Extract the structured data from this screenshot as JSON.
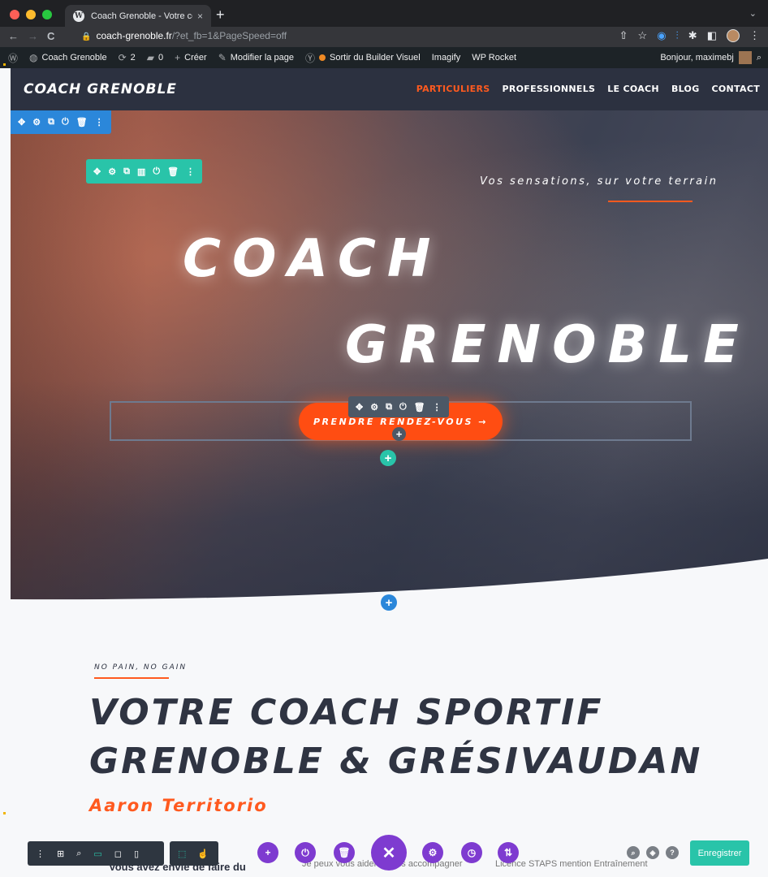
{
  "browser": {
    "tab_title": "Coach Grenoble - Votre coach",
    "favicon": "W",
    "close": "×",
    "new_tab": "+",
    "tab_menu": "⌄",
    "back": "←",
    "forward": "→",
    "reload": "C",
    "lock": "🔒",
    "url_host": "coach-grenoble.fr",
    "url_path": "/?et_fb=1&PageSpeed=off",
    "icons": [
      "⇧",
      "☆",
      "◉",
      "⫶",
      "✱",
      "◧",
      "⋮"
    ],
    "dot_colors": [
      "#ff5f57",
      "#febc2e",
      "#28c840"
    ]
  },
  "wp_admin": {
    "site": "Coach Grenoble",
    "updates": "2",
    "comments": "0",
    "create": "Créer",
    "edit_page": "Modifier la page",
    "exit_builder": "Sortir du Builder Visuel",
    "imagify": "Imagify",
    "wp_rocket": "WP Rocket",
    "greeting": "Bonjour, maximebj"
  },
  "site": {
    "logo": "COACH GRENOBLE",
    "menu": [
      "PARTICULIERS",
      "PROFESSIONNELS",
      "LE COACH",
      "BLOG",
      "CONTACT"
    ],
    "accent": "#ff5a1f"
  },
  "hero": {
    "tagline": "Vos sensations, sur votre terrain",
    "title_line1": "COACH",
    "title_line2": "GRENOBLE",
    "cta": "PRENDRE RENDEZ-VOUS →"
  },
  "divi": {
    "section_tools": [
      "✥",
      "⚙",
      "⧉",
      "⏻",
      "🗑",
      "⋮"
    ],
    "row_tools": [
      "✥",
      "⚙",
      "⧉",
      "▥",
      "⏻",
      "🗑",
      "⋮"
    ],
    "module_tools": [
      "✥",
      "⚙",
      "⧉",
      "⏻",
      "🗑",
      "⋮"
    ],
    "plus": "+",
    "section_color": "#2b87da",
    "row_color": "#29c4a9",
    "module_color": "#4c5866"
  },
  "content": {
    "kicker": "NO PAIN, NO GAIN",
    "heading_line1": "VOTRE COACH SPORTIF",
    "heading_line2": "GRENOBLE & GRÉSIVAUDAN",
    "author": "Aaron Territorio",
    "col1_peek": "Vous avez envie de faire du",
    "col2_peek": "Je peux vous aider à vous accompagner",
    "col3_peek": "Licence STAPS mention Entraînement"
  },
  "builder_bar": {
    "left_icons": [
      "⋮",
      "⊞",
      "⌕",
      "▭",
      "◻",
      "▯"
    ],
    "left2_icons": [
      "⬚",
      "☝"
    ],
    "center": [
      "+",
      "⏻",
      "🗑",
      "✕",
      "⚙",
      "◷",
      "⇅"
    ],
    "right": [
      "⌕",
      "◈",
      "?"
    ],
    "save": "Enregistrer",
    "purple": "#7e3bd0"
  }
}
